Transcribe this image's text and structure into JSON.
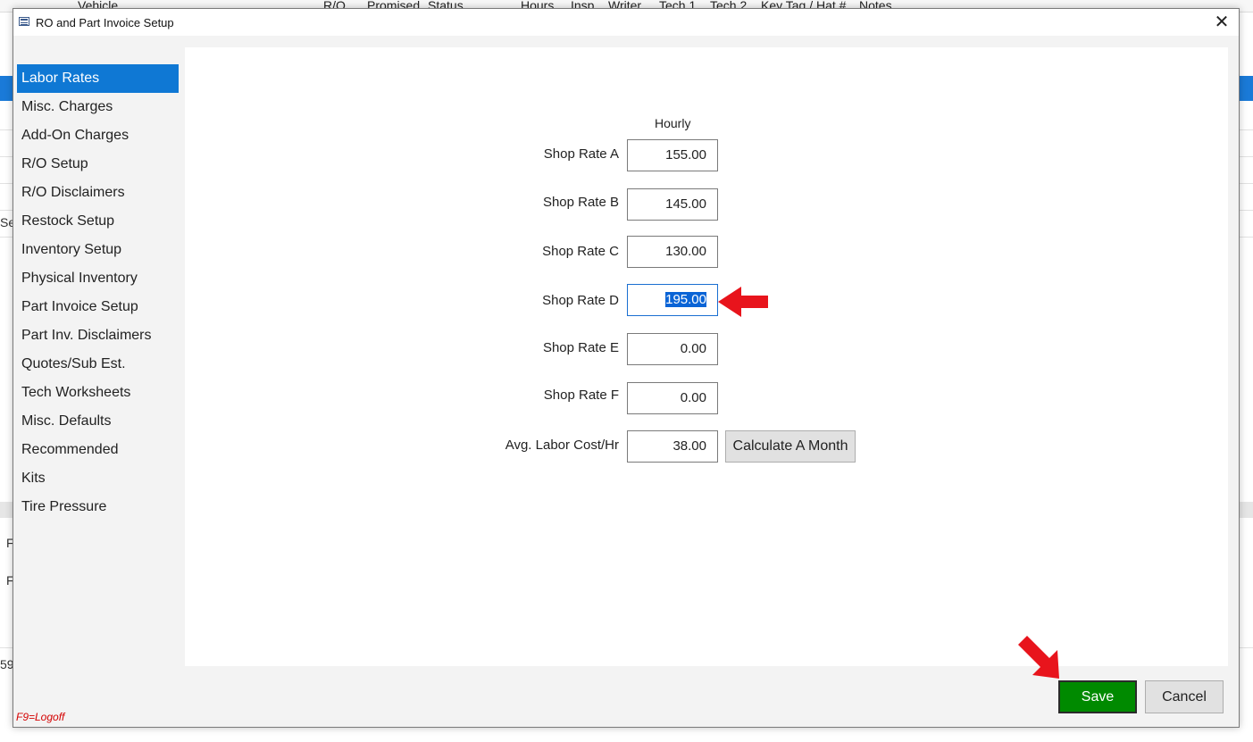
{
  "background": {
    "columns": [
      "Vehicle",
      "R/O",
      "Promised",
      "Status",
      "Hours",
      "Insp",
      "Writer",
      "Tech 1",
      "Tech 2",
      "Key Tag / Hat #",
      "Notes"
    ],
    "fragments": [
      "Ser",
      "F",
      "F",
      "59"
    ]
  },
  "dialog": {
    "title": "RO and Part Invoice Setup",
    "close_glyph": "✕"
  },
  "sidebar": {
    "items": [
      {
        "label": "Labor Rates",
        "active": true
      },
      {
        "label": "Misc. Charges"
      },
      {
        "label": "Add-On Charges"
      },
      {
        "label": "R/O Setup"
      },
      {
        "label": "R/O Disclaimers"
      },
      {
        "label": "Restock Setup"
      },
      {
        "label": "Inventory Setup"
      },
      {
        "label": "Physical Inventory"
      },
      {
        "label": "Part Invoice Setup"
      },
      {
        "label": "Part Inv. Disclaimers"
      },
      {
        "label": "Quotes/Sub Est."
      },
      {
        "label": "Tech Worksheets"
      },
      {
        "label": "Misc. Defaults"
      },
      {
        "label": "Recommended"
      },
      {
        "label": "Kits"
      },
      {
        "label": "Tire Pressure"
      }
    ]
  },
  "labor": {
    "column_header": "Hourly",
    "rates": [
      {
        "label": "Shop Rate A",
        "value": "155.00"
      },
      {
        "label": "Shop Rate B",
        "value": "145.00"
      },
      {
        "label": "Shop Rate C",
        "value": "130.00"
      },
      {
        "label": "Shop Rate D",
        "value": "195.00"
      },
      {
        "label": "Shop Rate E",
        "value": "0.00"
      },
      {
        "label": "Shop Rate F",
        "value": "0.00"
      }
    ],
    "avg_cost_label": "Avg. Labor Cost/Hr",
    "avg_cost_value": "38.00",
    "calculate_label": "Calculate A Month"
  },
  "footer": {
    "logoff_hint": "F9=Logoff",
    "save_label": "Save",
    "cancel_label": "Cancel"
  },
  "colors": {
    "accent": "#0f78d4",
    "save": "#008a00",
    "annotation_arrow": "#e8141c"
  }
}
